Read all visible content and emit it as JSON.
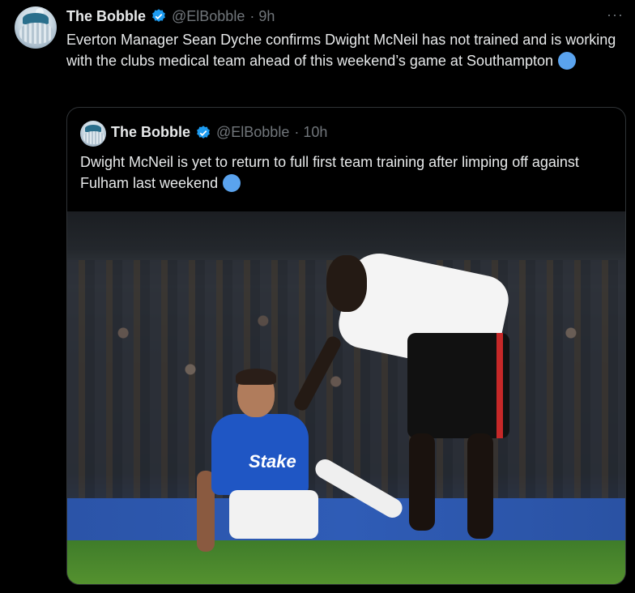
{
  "tweet": {
    "author_name": "The Bobble",
    "handle": "@ElBobble",
    "time": "· 9h",
    "more": "···",
    "text": "Everton Manager Sean Dyche confirms Dwight McNeil has not trained and is working with the clubs medical team ahead of this weekend’s game at Southampton"
  },
  "quoted": {
    "author_name": "The Bobble",
    "handle": "@ElBobble",
    "time": "· 10h",
    "text": "Dwight McNeil is yet to return to full first team training after limping off against Fulham last weekend"
  },
  "photo": {
    "shirt_sponsor": "Stake"
  },
  "colors": {
    "verified": "#1d9bf0",
    "muted": "#71767b",
    "emoji_dot": "#5aa3ee",
    "border": "#2f3336"
  }
}
